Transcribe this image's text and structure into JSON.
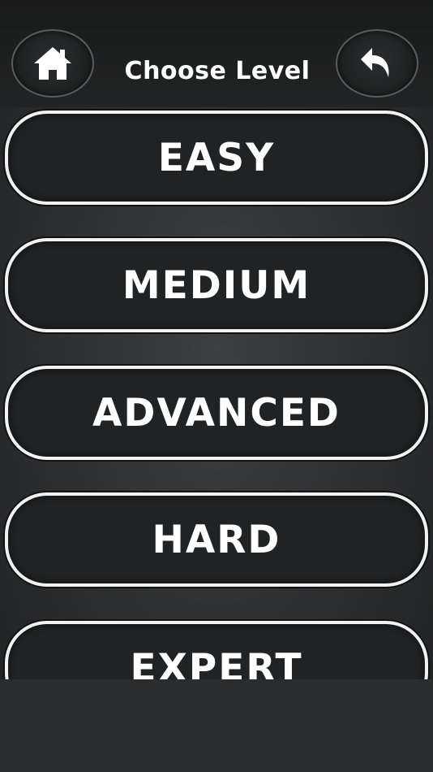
{
  "header": {
    "title": "Choose Level",
    "home_icon": "home-icon",
    "back_icon": "undo-arrow-icon"
  },
  "levels": [
    {
      "label": "EASY"
    },
    {
      "label": "MEDIUM"
    },
    {
      "label": "ADVANCED"
    },
    {
      "label": "HARD"
    },
    {
      "label": "EXPERT"
    }
  ],
  "colors": {
    "background": "#2b2c2d",
    "header": "#1c1d1d",
    "button_fill": "#212223",
    "button_border": "#f2f2f2",
    "text": "#ffffff"
  }
}
